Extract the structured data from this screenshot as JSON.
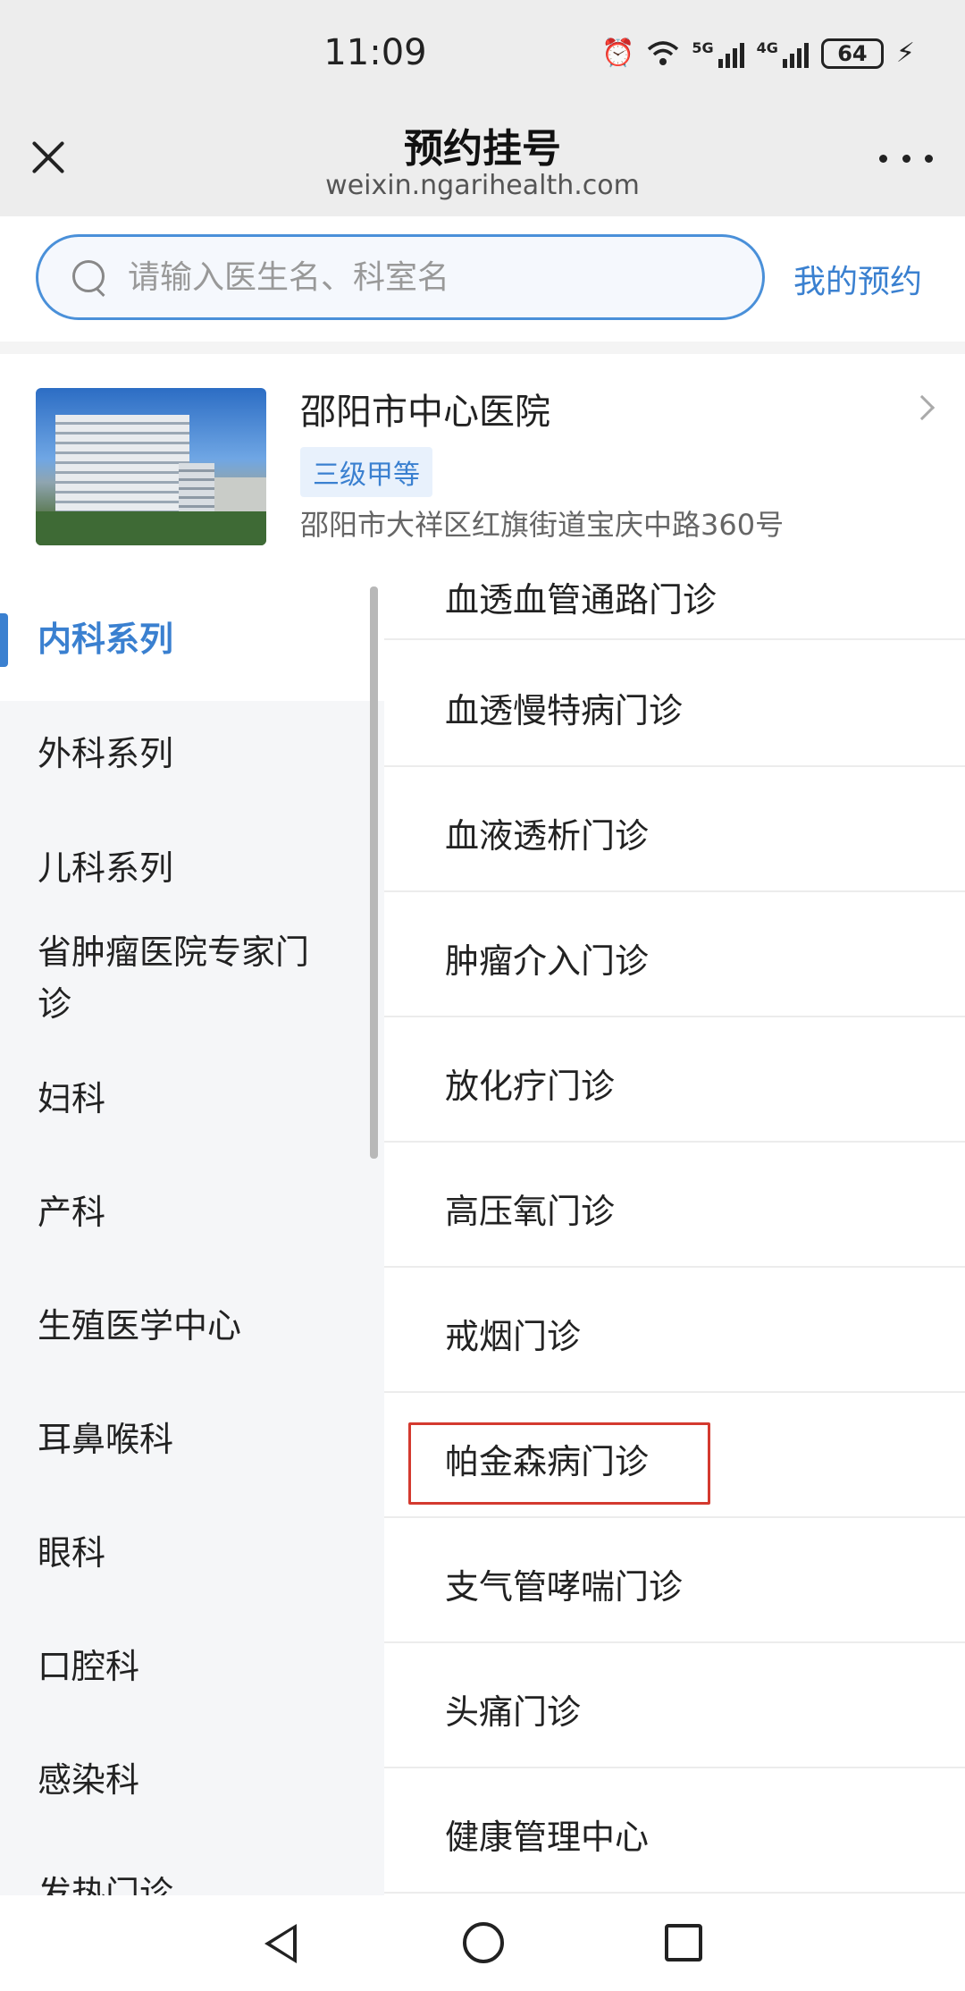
{
  "status": {
    "time": "11:09",
    "battery": "64",
    "net1": "5G",
    "net2": "4G"
  },
  "nav": {
    "title": "预约挂号",
    "subtitle": "weixin.ngarihealth.com"
  },
  "search": {
    "placeholder": "请输入医生名、科室名",
    "my_appointments": "我的预约"
  },
  "hospital": {
    "name": "邵阳市中心医院",
    "level": "三级甲等",
    "address": "邵阳市大祥区红旗街道宝庆中路360号"
  },
  "sidebar": {
    "items": [
      {
        "label": "内科系列",
        "active": true
      },
      {
        "label": "外科系列"
      },
      {
        "label": "儿科系列"
      },
      {
        "label": "省肿瘤医院专家门诊"
      },
      {
        "label": "妇科"
      },
      {
        "label": "产科"
      },
      {
        "label": "生殖医学中心"
      },
      {
        "label": "耳鼻喉科"
      },
      {
        "label": "眼科"
      },
      {
        "label": "口腔科"
      },
      {
        "label": "感染科"
      },
      {
        "label": "发热门诊"
      }
    ]
  },
  "departments": {
    "items": [
      {
        "label": "血透血管通路门诊"
      },
      {
        "label": "血透慢特病门诊"
      },
      {
        "label": "血液透析门诊"
      },
      {
        "label": "肿瘤介入门诊"
      },
      {
        "label": "放化疗门诊"
      },
      {
        "label": "高压氧门诊"
      },
      {
        "label": "戒烟门诊"
      },
      {
        "label": "帕金森病门诊",
        "highlighted": true
      },
      {
        "label": "支气管哮喘门诊"
      },
      {
        "label": "头痛门诊"
      },
      {
        "label": "健康管理中心"
      }
    ]
  }
}
